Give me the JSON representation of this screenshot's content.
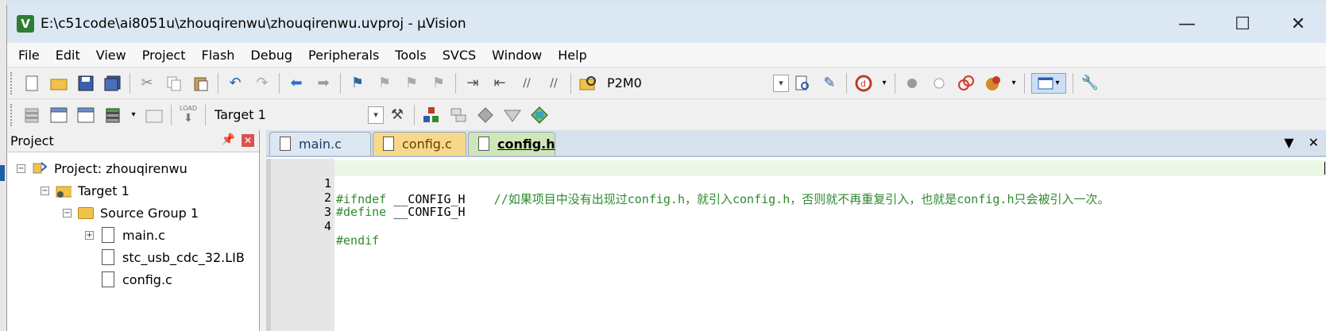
{
  "window": {
    "title": "E:\\c51code\\ai8051u\\zhouqirenwu\\zhouqirenwu.uvproj - µVision",
    "app_icon_letter": "V",
    "minimize": "—",
    "maximize": "☐",
    "close": "✕"
  },
  "menu": [
    "File",
    "Edit",
    "View",
    "Project",
    "Flash",
    "Debug",
    "Peripherals",
    "Tools",
    "SVCS",
    "Window",
    "Help"
  ],
  "toolbar1": {
    "find_combo_value": "P2M0"
  },
  "toolbar2": {
    "target_combo_value": "Target 1",
    "load_label": "LOAD"
  },
  "project_pane": {
    "title": "Project",
    "pin": "📌",
    "close": "✕",
    "tree": [
      {
        "label": "Project: zhouqirenwu",
        "toggle": "−",
        "icon": "project-icon"
      },
      {
        "label": "Target 1",
        "toggle": "−",
        "icon": "target-folder-icon"
      },
      {
        "label": "Source Group 1",
        "toggle": "−",
        "icon": "folder-icon"
      },
      {
        "label": "main.c",
        "toggle": "+",
        "icon": "file-icon"
      },
      {
        "label": "stc_usb_cdc_32.LIB",
        "toggle": "",
        "icon": "file-icon"
      },
      {
        "label": "config.c",
        "toggle": "",
        "icon": "file-icon"
      }
    ]
  },
  "editor": {
    "tabs": [
      {
        "label": "main.c",
        "active": false
      },
      {
        "label": "config.c",
        "active": false
      },
      {
        "label": "config.h",
        "active": true
      }
    ],
    "tab_menu": "▼",
    "tab_close": "✕",
    "lines": [
      {
        "no": "1",
        "directive": "#ifndef",
        "rest": " __CONFIG_H",
        "comment": "    //如果项目中没有出现过config.h，就引入config.h，否则就不再重复引入，也就是config.h只会被引入一次。"
      },
      {
        "no": "2",
        "directive": "#define",
        "rest": " __CONFIG_H",
        "comment": ""
      },
      {
        "no": "3",
        "directive": "",
        "rest": "",
        "comment": ""
      },
      {
        "no": "4",
        "directive": "#endif",
        "rest": "",
        "comment": ""
      }
    ]
  },
  "colors": {
    "titlebar": "#dbe7f3",
    "preprocessor": "#2e8b2e",
    "active_tab": "#cfe6b8"
  }
}
